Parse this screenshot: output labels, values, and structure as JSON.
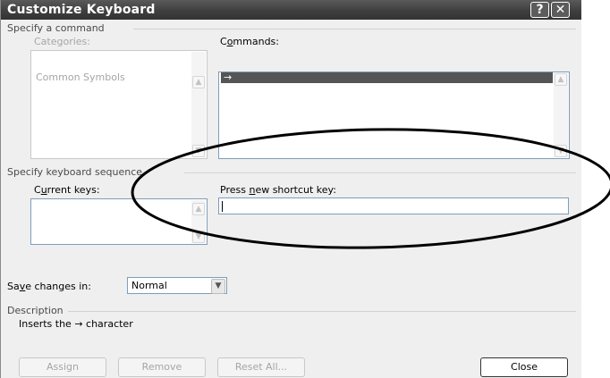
{
  "window": {
    "title": "Customize Keyboard",
    "help_glyph": "?",
    "close_glyph": "✕"
  },
  "specify_command": {
    "group_label": "Specify a command",
    "categories_label": "Categories:",
    "categories_items": [
      "Common Symbols"
    ],
    "commands_label_pre": "C",
    "commands_label_ul": "o",
    "commands_label_post": "mmands:",
    "commands_items": [
      "→"
    ]
  },
  "keyboard_sequence": {
    "group_label": "Specify keyboard sequence",
    "current_keys_pre": "C",
    "current_keys_ul": "u",
    "current_keys_post": "rrent keys:",
    "press_new_pre": "Press ",
    "press_new_ul": "n",
    "press_new_post": "ew shortcut key:",
    "press_new_value": ""
  },
  "save_changes": {
    "label_pre": "Sa",
    "label_ul": "v",
    "label_post": "e changes in:",
    "selected": "Normal"
  },
  "description": {
    "group_label": "Description",
    "text": "Inserts the → character"
  },
  "buttons": {
    "assign": "Assign",
    "remove": "Remove",
    "reset_all": "Reset All...",
    "close": "Close"
  },
  "icons": {
    "scroll_up": "▲",
    "scroll_down": "▼",
    "dropdown": "▼"
  }
}
